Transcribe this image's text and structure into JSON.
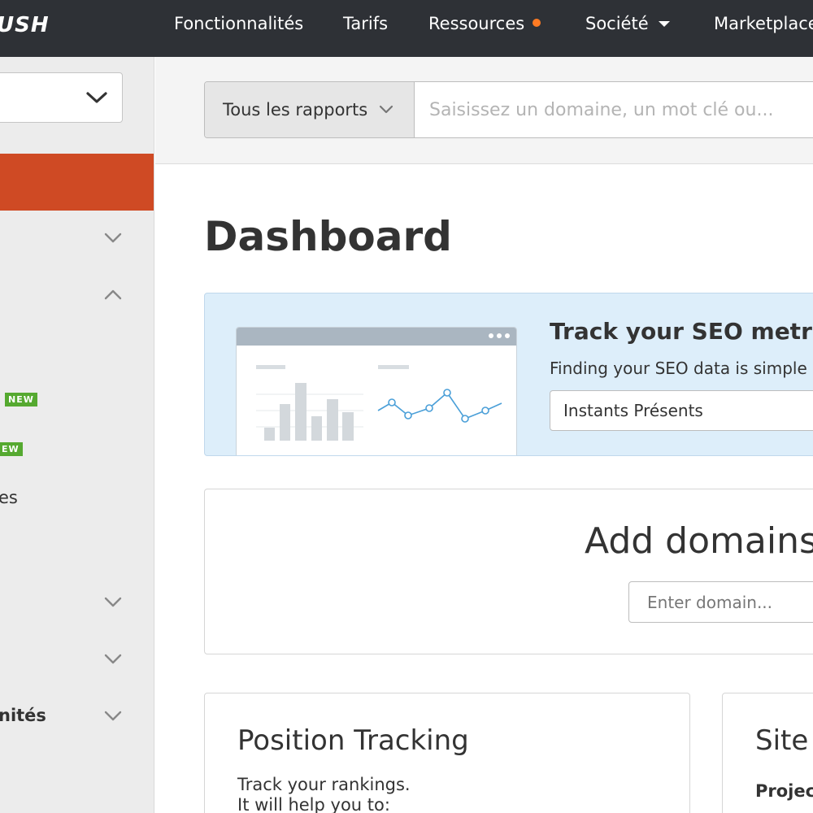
{
  "topnav": {
    "logo": "USH",
    "items": [
      {
        "label": "Fonctionnalités"
      },
      {
        "label": "Tarifs"
      },
      {
        "label": "Ressources"
      },
      {
        "label": "Société"
      },
      {
        "label": "Marketplace"
      }
    ]
  },
  "sidebar": {
    "new_badge_1": "NEW",
    "new_badge_2": "EW",
    "partial_label_1": "es",
    "partial_label_2": "nités"
  },
  "search": {
    "reports_label": "Tous les rapports",
    "placeholder": "Saisissez un domaine, un mot clé ou..."
  },
  "main": {
    "page_title": "Dashboard",
    "banner": {
      "title": "Track your SEO metrics",
      "subtitle": "Finding your SEO data is simple",
      "project_select": "Instants Présents"
    },
    "add_domains": {
      "title": "Add domains",
      "input_placeholder": "Enter domain..."
    },
    "cards": {
      "position_tracking": {
        "title": "Position Tracking",
        "desc_line1": "Track your rankings.",
        "desc_line2": "It will help you to:"
      },
      "site_audit": {
        "title": "Site A",
        "sub": "Projec"
      }
    }
  },
  "colors": {
    "topnav_bg": "#2e3136",
    "sidebar_active": "#cf4a24",
    "new_badge": "#55a930",
    "notification_dot": "#ff7b23",
    "banner_bg": "#ddeefa",
    "chart_line": "#4a9fd8"
  }
}
